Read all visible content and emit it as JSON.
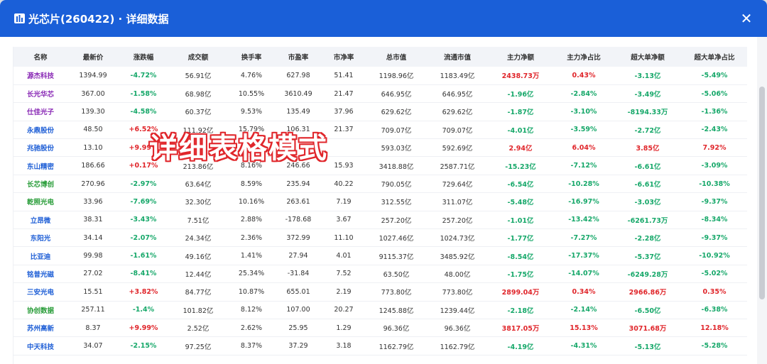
{
  "window": {
    "title": "光芯片(260422) · 详细数据",
    "close_label": "✕",
    "title_icon": "chart-icon"
  },
  "overlay": {
    "caption": "详细表格模式"
  },
  "colors": {
    "accent": "#1a5fd8",
    "up": "#e0262b",
    "down": "#17a86a"
  },
  "table": {
    "headers": [
      "名称",
      "最新价",
      "涨跌幅",
      "成交额",
      "换手率",
      "市盈率",
      "市净率",
      "总市值",
      "流通市值",
      "主力净额",
      "主力净占比",
      "超大单净额",
      "超大单净占比"
    ],
    "rows": [
      {
        "name": "源杰科技",
        "name_color": "purple",
        "cells": [
          "1394.99",
          "-4.72%",
          "56.91亿",
          "4.76%",
          "627.98",
          "51.41",
          "1198.96亿",
          "1183.49亿",
          "2438.73万",
          "0.43%",
          "-3.13亿",
          "-5.49%"
        ]
      },
      {
        "name": "长光华芯",
        "name_color": "purple",
        "cells": [
          "367.00",
          "-1.58%",
          "68.98亿",
          "10.55%",
          "3610.49",
          "21.47",
          "646.95亿",
          "646.95亿",
          "-1.96亿",
          "-2.84%",
          "-3.49亿",
          "-5.06%"
        ]
      },
      {
        "name": "仕佳光子",
        "name_color": "purple",
        "cells": [
          "139.30",
          "-4.58%",
          "60.37亿",
          "9.53%",
          "135.49",
          "37.96",
          "629.62亿",
          "629.62亿",
          "-1.87亿",
          "-3.10%",
          "-8194.33万",
          "-1.36%"
        ]
      },
      {
        "name": "永鼎股份",
        "name_color": "blue",
        "cells": [
          "48.50",
          "+6.52%",
          "111.92亿",
          "15.79%",
          "106.31",
          "21.37",
          "709.07亿",
          "709.07亿",
          "-4.01亿",
          "-3.59%",
          "-2.72亿",
          "-2.43%"
        ]
      },
      {
        "name": "兆驰股份",
        "name_color": "blue",
        "cells": [
          "13.10",
          "+9.99%",
          "",
          "",
          "",
          "",
          "593.03亿",
          "592.69亿",
          "2.94亿",
          "6.04%",
          "3.85亿",
          "7.92%"
        ]
      },
      {
        "name": "东山精密",
        "name_color": "blue",
        "cells": [
          "186.66",
          "+0.17%",
          "213.86亿",
          "8.16%",
          "246.66",
          "15.93",
          "3418.88亿",
          "2587.71亿",
          "-15.23亿",
          "-7.12%",
          "-6.61亿",
          "-3.09%"
        ]
      },
      {
        "name": "长芯博创",
        "name_color": "green",
        "cells": [
          "270.96",
          "-2.97%",
          "63.64亿",
          "8.59%",
          "235.94",
          "40.22",
          "790.05亿",
          "729.64亿",
          "-6.54亿",
          "-10.28%",
          "-6.61亿",
          "-10.38%"
        ]
      },
      {
        "name": "乾照光电",
        "name_color": "green",
        "cells": [
          "33.96",
          "-7.69%",
          "32.30亿",
          "10.16%",
          "263.61",
          "7.19",
          "312.55亿",
          "311.07亿",
          "-5.48亿",
          "-16.97%",
          "-3.03亿",
          "-9.37%"
        ]
      },
      {
        "name": "立昂微",
        "name_color": "blue",
        "cells": [
          "38.31",
          "-3.43%",
          "7.51亿",
          "2.88%",
          "-178.68",
          "3.67",
          "257.20亿",
          "257.20亿",
          "-1.01亿",
          "-13.42%",
          "-6261.73万",
          "-8.34%"
        ]
      },
      {
        "name": "东阳光",
        "name_color": "blue",
        "cells": [
          "34.14",
          "-2.07%",
          "24.34亿",
          "2.36%",
          "372.99",
          "11.10",
          "1027.46亿",
          "1024.73亿",
          "-1.77亿",
          "-7.27%",
          "-2.28亿",
          "-9.37%"
        ]
      },
      {
        "name": "比亚迪",
        "name_color": "blue",
        "cells": [
          "99.98",
          "-1.61%",
          "49.16亿",
          "1.41%",
          "27.94",
          "4.01",
          "9115.37亿",
          "3485.92亿",
          "-8.54亿",
          "-17.37%",
          "-5.37亿",
          "-10.92%"
        ]
      },
      {
        "name": "铭普光磁",
        "name_color": "blue",
        "cells": [
          "27.02",
          "-8.41%",
          "12.44亿",
          "25.34%",
          "-31.84",
          "7.52",
          "63.50亿",
          "48.00亿",
          "-1.75亿",
          "-14.07%",
          "-6249.28万",
          "-5.02%"
        ]
      },
      {
        "name": "三安光电",
        "name_color": "blue",
        "cells": [
          "15.51",
          "+3.82%",
          "84.77亿",
          "10.87%",
          "655.01",
          "2.19",
          "773.80亿",
          "773.80亿",
          "2899.04万",
          "0.34%",
          "2966.86万",
          "0.35%"
        ]
      },
      {
        "name": "协创数据",
        "name_color": "green",
        "cells": [
          "257.11",
          "-1.4%",
          "101.82亿",
          "8.12%",
          "107.00",
          "20.27",
          "1245.88亿",
          "1239.44亿",
          "-2.18亿",
          "-2.14%",
          "-6.50亿",
          "-6.38%"
        ]
      },
      {
        "name": "苏州高新",
        "name_color": "blue",
        "cells": [
          "8.37",
          "+9.99%",
          "2.52亿",
          "2.62%",
          "25.95",
          "1.29",
          "96.36亿",
          "96.36亿",
          "3817.05万",
          "15.13%",
          "3071.68万",
          "12.18%"
        ]
      },
      {
        "name": "中天科技",
        "name_color": "blue",
        "cells": [
          "34.07",
          "-2.15%",
          "97.25亿",
          "8.37%",
          "37.29",
          "3.18",
          "1162.79亿",
          "1162.79亿",
          "-4.19亿",
          "-4.31%",
          "-5.13亿",
          "-5.28%"
        ]
      },
      {
        "name": "",
        "name_color": "blue",
        "cells": [
          "",
          "",
          "",
          "",
          "",
          "",
          "",
          "",
          "",
          "",
          "",
          ""
        ]
      }
    ]
  }
}
